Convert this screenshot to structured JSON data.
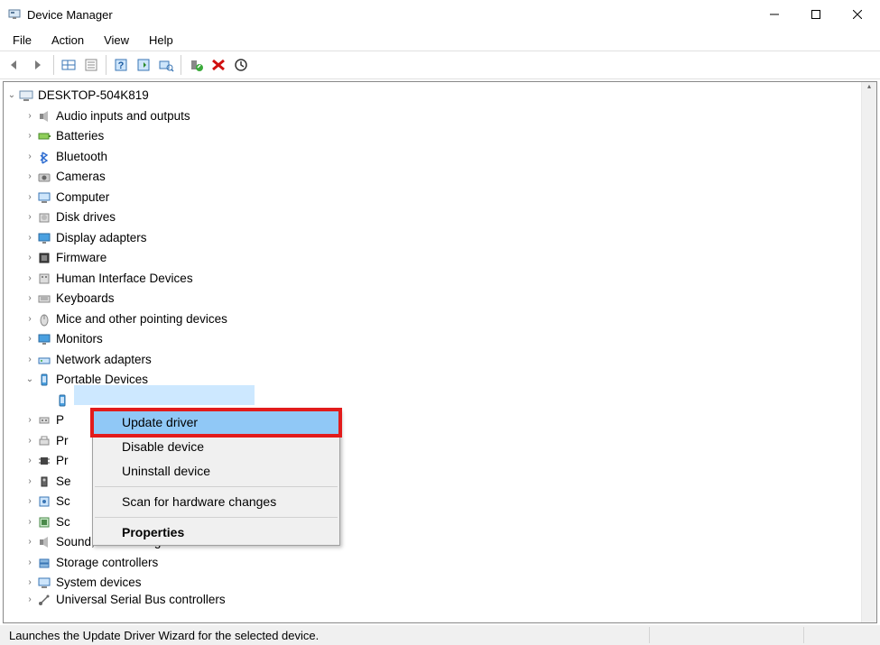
{
  "window": {
    "title": "Device Manager"
  },
  "menus": [
    "File",
    "Action",
    "View",
    "Help"
  ],
  "toolbar_icons": [
    "back",
    "forward",
    "show-hidden",
    "properties",
    "help",
    "update-driver",
    "uninstall",
    "scan",
    "disable",
    "add-legacy"
  ],
  "tree": {
    "root": {
      "label": "DESKTOP-504K819",
      "expanded": true
    },
    "categories": [
      {
        "label": "Audio inputs and outputs",
        "icon": "speaker"
      },
      {
        "label": "Batteries",
        "icon": "battery"
      },
      {
        "label": "Bluetooth",
        "icon": "bluetooth"
      },
      {
        "label": "Cameras",
        "icon": "camera"
      },
      {
        "label": "Computer",
        "icon": "computer"
      },
      {
        "label": "Disk drives",
        "icon": "disk"
      },
      {
        "label": "Display adapters",
        "icon": "display"
      },
      {
        "label": "Firmware",
        "icon": "firmware"
      },
      {
        "label": "Human Interface Devices",
        "icon": "hid"
      },
      {
        "label": "Keyboards",
        "icon": "keyboard"
      },
      {
        "label": "Mice and other pointing devices",
        "icon": "mouse"
      },
      {
        "label": "Monitors",
        "icon": "monitor"
      },
      {
        "label": "Network adapters",
        "icon": "network"
      },
      {
        "label": "Portable Devices",
        "icon": "portable",
        "expanded": true
      },
      {
        "label": "P",
        "icon": "port",
        "truncated": true
      },
      {
        "label": "Pr",
        "icon": "printqueue",
        "truncated": true
      },
      {
        "label": "Pr",
        "icon": "processor",
        "truncated": true
      },
      {
        "label": "Se",
        "icon": "security",
        "truncated": true
      },
      {
        "label": "Sc",
        "icon": "software",
        "truncated": true
      },
      {
        "label": "Sc",
        "icon": "softwarecomp",
        "truncated": true
      },
      {
        "label": "Sound, video and game controllers",
        "icon": "sound",
        "truncated_prefix": true
      },
      {
        "label": "Storage controllers",
        "icon": "storage"
      },
      {
        "label": "System devices",
        "icon": "system"
      },
      {
        "label": "Universal Serial Bus controllers",
        "icon": "usb",
        "cut": true
      }
    ],
    "portable_child": {
      "label": "",
      "icon": "phone",
      "selected": true
    }
  },
  "context_menu": {
    "items": [
      {
        "label": "Update driver",
        "highlight": true
      },
      {
        "label": "Disable device"
      },
      {
        "label": "Uninstall device"
      },
      {
        "sep": true
      },
      {
        "label": "Scan for hardware changes"
      },
      {
        "sep": true
      },
      {
        "label": "Properties",
        "bold": true
      }
    ]
  },
  "statusbar": {
    "text": "Launches the Update Driver Wizard for the selected device."
  }
}
